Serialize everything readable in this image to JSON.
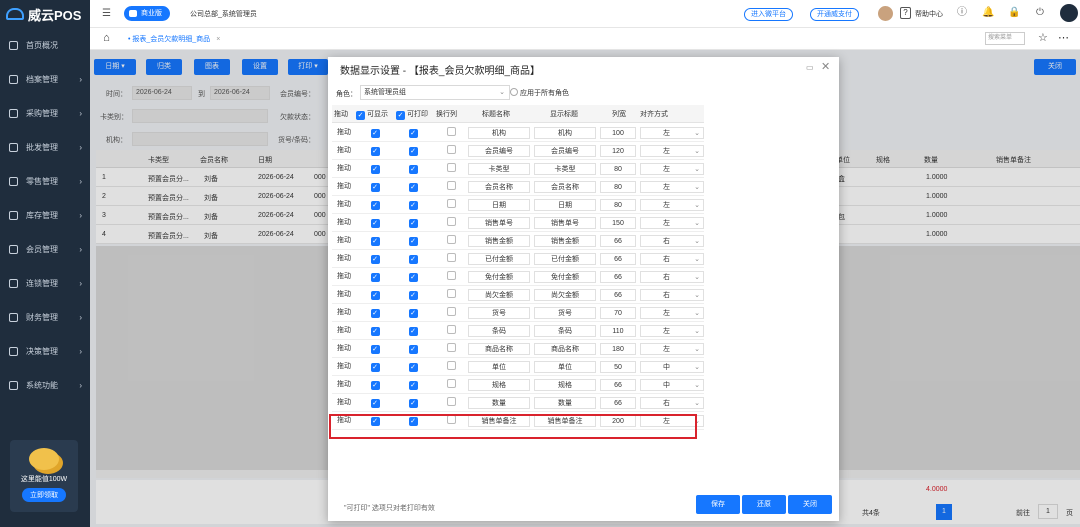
{
  "app": {
    "name": "威云POS"
  },
  "sidebar": {
    "items": [
      {
        "label": "首页概况",
        "chevron": ""
      },
      {
        "label": "档案管理",
        "chevron": "›"
      },
      {
        "label": "采购管理",
        "chevron": "›"
      },
      {
        "label": "批发管理",
        "chevron": "›"
      },
      {
        "label": "零售管理",
        "chevron": "›"
      },
      {
        "label": "库存管理",
        "chevron": "›"
      },
      {
        "label": "会员管理",
        "chevron": "›"
      },
      {
        "label": "连锁管理",
        "chevron": "›"
      },
      {
        "label": "财务管理",
        "chevron": "›"
      },
      {
        "label": "决策管理",
        "chevron": "›"
      },
      {
        "label": "系统功能",
        "chevron": "›"
      }
    ],
    "promo": {
      "text": "这里能值100W",
      "button": "立即领取"
    }
  },
  "topbar": {
    "collapse_glyph": "☰",
    "edition_badge": "商业版",
    "company": "公司总部_系统管理员",
    "link_cloud": "进入微平台",
    "link_pay": "开通威支付",
    "help_glyph": "?",
    "help": "帮助中心",
    "icons": {
      "info": "ⓘ",
      "bell": "🔔",
      "lock": "🔒",
      "power": "⏻"
    }
  },
  "tabbar": {
    "home_glyph": "⌂",
    "active_tab": "• 报表_会员欠款明细_商品",
    "close_glyph": "×",
    "search_placeholder": "搜索菜单",
    "star_glyph": "☆",
    "more_glyph": "⋯"
  },
  "toolbar": {
    "buttons": [
      "日期 ▾",
      "归类",
      "图表",
      "设置",
      "打印 ▾"
    ],
    "close": "关闭"
  },
  "filters": {
    "time_label": "时间：",
    "date_from": "2026-06-24",
    "to_label": "到",
    "date_to": "2026-06-24",
    "member_no_label": "会员编号：",
    "card_type_label": "卡类别：",
    "debt_status_label": "欠款状态：",
    "org_label": "机构：",
    "item_no_label": "货号/条码："
  },
  "grid": {
    "headers": [
      "卡类型",
      "会员名称",
      "日期",
      "单位",
      "规格",
      "数量",
      "销售单备注"
    ],
    "rows": [
      {
        "no": "1",
        "card": "预置会员分...",
        "name": "刘备",
        "date": "2026-06-24",
        "code": "000",
        "unit": "盒",
        "qty": "1.0000"
      },
      {
        "no": "2",
        "card": "预置会员分...",
        "name": "刘备",
        "date": "2026-06-24",
        "code": "000",
        "unit": "",
        "qty": "1.0000"
      },
      {
        "no": "3",
        "card": "预置会员分...",
        "name": "刘备",
        "date": "2026-06-24",
        "code": "000",
        "unit": "包",
        "qty": "1.0000"
      },
      {
        "no": "4",
        "card": "预置会员分...",
        "name": "刘备",
        "date": "2026-06-24",
        "code": "000",
        "unit": "",
        "qty": "1.0000"
      }
    ],
    "total_qty": "4.0000",
    "pager": {
      "count": "共4条",
      "page": "1",
      "goto_label": "前往",
      "goto_value": "1",
      "page_unit": "页"
    }
  },
  "modal": {
    "title": "数据显示设置 - 【报表_会员欠款明细_商品】",
    "minimize_glyph": "▭",
    "close_glyph": "✕",
    "role_label": "角色：",
    "role_value": "系统管理员组",
    "apply_all": "应用于所有角色",
    "columns": {
      "drag": "拖动",
      "visible": "可显示",
      "printable": "可打印",
      "wrap": "换行列",
      "title": "标题名称",
      "display_title": "显示标题",
      "width": "列宽",
      "align": "对齐方式"
    },
    "rows": [
      {
        "drag": "拖动",
        "title": "机构",
        "display": "机构",
        "width": "100",
        "align": "左"
      },
      {
        "drag": "拖动",
        "title": "会员编号",
        "display": "会员编号",
        "width": "120",
        "align": "左"
      },
      {
        "drag": "拖动",
        "title": "卡类型",
        "display": "卡类型",
        "width": "80",
        "align": "左"
      },
      {
        "drag": "拖动",
        "title": "会员名称",
        "display": "会员名称",
        "width": "80",
        "align": "左"
      },
      {
        "drag": "拖动",
        "title": "日期",
        "display": "日期",
        "width": "80",
        "align": "左"
      },
      {
        "drag": "拖动",
        "title": "销售单号",
        "display": "销售单号",
        "width": "150",
        "align": "左"
      },
      {
        "drag": "拖动",
        "title": "销售金额",
        "display": "销售金额",
        "width": "66",
        "align": "右"
      },
      {
        "drag": "拖动",
        "title": "已付金额",
        "display": "已付金额",
        "width": "66",
        "align": "右"
      },
      {
        "drag": "拖动",
        "title": "免付金额",
        "display": "免付金额",
        "width": "66",
        "align": "右"
      },
      {
        "drag": "拖动",
        "title": "尚欠金额",
        "display": "尚欠金额",
        "width": "66",
        "align": "右"
      },
      {
        "drag": "拖动",
        "title": "货号",
        "display": "货号",
        "width": "70",
        "align": "左"
      },
      {
        "drag": "拖动",
        "title": "条码",
        "display": "条码",
        "width": "110",
        "align": "左"
      },
      {
        "drag": "拖动",
        "title": "商品名称",
        "display": "商品名称",
        "width": "180",
        "align": "左"
      },
      {
        "drag": "拖动",
        "title": "单位",
        "display": "单位",
        "width": "50",
        "align": "中"
      },
      {
        "drag": "拖动",
        "title": "规格",
        "display": "规格",
        "width": "66",
        "align": "中"
      },
      {
        "drag": "拖动",
        "title": "数量",
        "display": "数量",
        "width": "66",
        "align": "右"
      },
      {
        "drag": "拖动",
        "title": "销售单备注",
        "display": "销售单备注",
        "width": "200",
        "align": "左"
      }
    ],
    "note": "\"可打印\" 选项只对老打印有效",
    "buttons": {
      "save": "保存",
      "restore": "还原",
      "close": "关闭"
    }
  },
  "colors": {
    "primary": "#1677ff",
    "sidebar": "#1f2d3d",
    "highlight": "#d9232d"
  }
}
